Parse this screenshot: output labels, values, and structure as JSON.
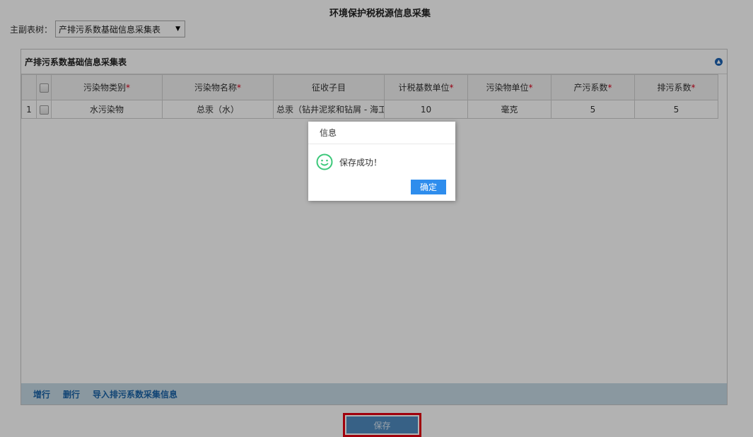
{
  "page": {
    "title": "环境保护税税源信息采集"
  },
  "tree": {
    "label": "主副表树：",
    "selected": "产排污系数基础信息采集表"
  },
  "panel": {
    "title": "产排污系数基础信息采集表",
    "columns": [
      "污染物类别",
      "污染物名称",
      "征收子目",
      "计税基数单位",
      "污染物单位",
      "产污系数",
      "排污系数"
    ],
    "required_marker": "*",
    "rows": [
      {
        "index": "1",
        "pollutant_category": "水污染物",
        "pollutant_name": "总汞（水）",
        "sub_item": "总汞（钻井泥浆和钻屑 - 海工",
        "tax_base_unit": "10",
        "pollutant_unit": "毫克",
        "production_coefficient": "5",
        "discharge_coefficient": "5"
      }
    ]
  },
  "footer": {
    "add_row": "增行",
    "delete_row": "删行",
    "import": "导入排污系数采集信息"
  },
  "save_button": "保存",
  "dialog": {
    "title": "信息",
    "message": "保存成功！",
    "ok": "确定",
    "icon": "smile-icon"
  },
  "colors": {
    "accent": "#2e8ded",
    "highlight_border": "#e60012",
    "footer_bar": "#c6dae6",
    "link": "#1a64a8"
  }
}
